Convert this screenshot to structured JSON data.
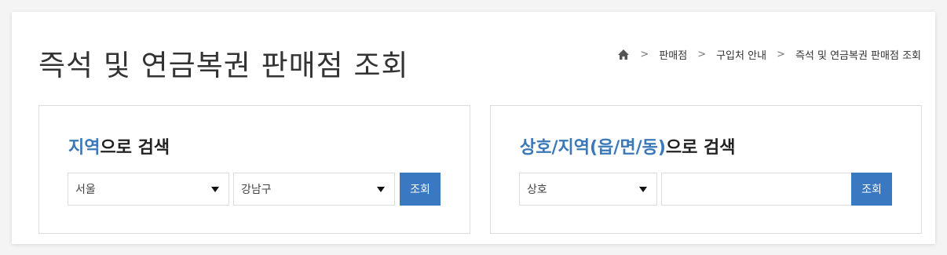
{
  "page": {
    "title": "즉석 및 연금복권 판매점 조회"
  },
  "breadcrumb": {
    "home_icon": "home-icon",
    "separator": ">",
    "items": [
      "판매점",
      "구입처 안내",
      "즉석 및 연금복권 판매점 조회"
    ]
  },
  "region_search": {
    "heading_accent": "지역",
    "heading_rest": "으로 검색",
    "city_select": {
      "value": "서울"
    },
    "district_select": {
      "value": "강남구"
    },
    "search_button": "조회"
  },
  "name_search": {
    "heading_accent": "상호/지역(읍/면/동)",
    "heading_rest": "으로 검색",
    "type_select": {
      "value": "상호"
    },
    "keyword_input": {
      "value": "",
      "placeholder": ""
    },
    "search_button": "조회"
  },
  "colors": {
    "accent": "#3a78b8",
    "button": "#3a78c2",
    "border": "#dcdcdc"
  }
}
